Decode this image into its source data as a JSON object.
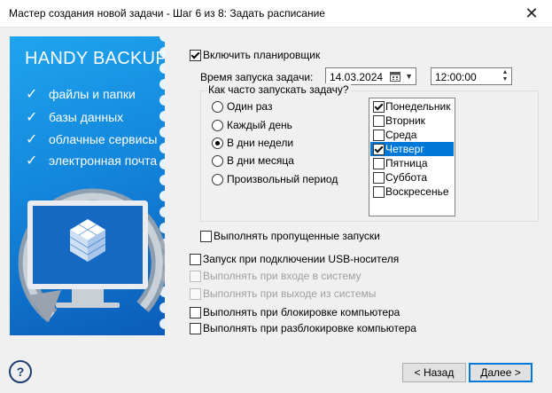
{
  "window": {
    "title": "Мастер создания новой задачи - Шаг 6 из 8: Задать расписание",
    "close_glyph": "✕"
  },
  "banner": {
    "brand": "HANDY BACKUP",
    "features": [
      "файлы и папки",
      "базы данных",
      "облачные сервисы",
      "электронная почта"
    ],
    "check_glyph": "✓"
  },
  "scheduler": {
    "enable_label": "Включить планировщик",
    "enable_checked": true,
    "time_label": "Время запуска задачи:",
    "date_value": "14.03.2024",
    "time_value": "12:00:00",
    "frequency_label": "Как часто запускать задачу?",
    "options": [
      "Один раз",
      "Каждый день",
      "В дни недели",
      "В дни месяца",
      "Произвольный период"
    ],
    "selected_option": "В дни недели",
    "days": [
      {
        "label": "Понедельник",
        "checked": true,
        "selected": false
      },
      {
        "label": "Вторник",
        "checked": false,
        "selected": false
      },
      {
        "label": "Среда",
        "checked": false,
        "selected": false
      },
      {
        "label": "Четверг",
        "checked": true,
        "selected": true
      },
      {
        "label": "Пятница",
        "checked": false,
        "selected": false
      },
      {
        "label": "Суббота",
        "checked": false,
        "selected": false
      },
      {
        "label": "Воскресенье",
        "checked": false,
        "selected": false
      }
    ],
    "missed_label": "Выполнять пропущенные запуски"
  },
  "triggers": [
    {
      "label": "Запуск при подключении USB-носителя",
      "enabled": true
    },
    {
      "label": "Выполнять при входе в систему",
      "enabled": false
    },
    {
      "label": "Выполнять при выходе из системы",
      "enabled": false
    },
    {
      "label": "Выполнять при блокировке компьютера",
      "enabled": true
    },
    {
      "label": "Выполнять при разблокировке компьютера",
      "enabled": true
    }
  ],
  "footer": {
    "help": "?",
    "back": "< Назад",
    "next": "Далее >"
  },
  "colors": {
    "accent": "#0078d7",
    "banner_top": "#1fa5ef",
    "banner_bottom": "#0b5cb8"
  }
}
